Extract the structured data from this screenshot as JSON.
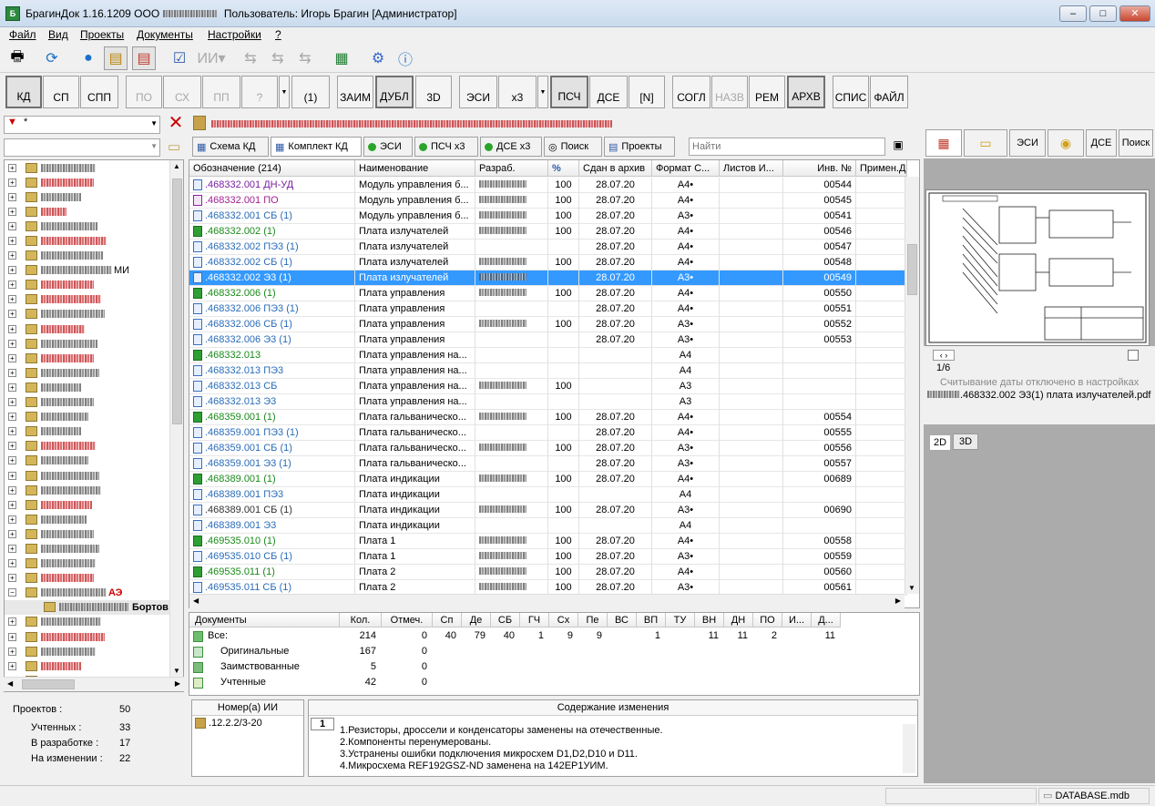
{
  "window": {
    "title": "БрагинДок 1.16.1209  ООО",
    "user": "Пользователь: Игорь Брагин  [Администратор]",
    "controls": [
      "–",
      "□",
      "✕"
    ]
  },
  "menu": [
    "Файл",
    "Вид",
    "Проекты",
    "Документы",
    "Настройки",
    "?"
  ],
  "doc_type_buttons": {
    "kd": "КД",
    "sp": "СП",
    "spp": "СПП",
    "po": "ПО",
    "sh": "СХ",
    "pp": "ПП",
    "q": "?",
    "one": "(1)",
    "zaim": "ЗАИМ",
    "dubl": "ДУБЛ",
    "d3": "3D",
    "esi": "ЭСИ",
    "x3": "x3",
    "psch": "ПСЧ",
    "dse": "ДСЕ",
    "n": "[N]",
    "sogl": "СОГЛ",
    "nazv": "НАЗВ",
    "rem": "РЕМ",
    "arhv": "АРХВ",
    "spis": "СПИС",
    "fail": "ФАЙЛ"
  },
  "filter": {
    "value": "*"
  },
  "tabs": {
    "schema": "Схема КД",
    "komplekt": "Комплект КД",
    "esi": "ЭСИ",
    "psch": "ПСЧ x3",
    "dse": "ДСЕ x3",
    "search": "Поиск",
    "projects": "Проекты",
    "search_placeholder": "Найти"
  },
  "grid": {
    "headers": [
      "Обозначение (214)",
      "Наименование",
      "Разраб.",
      "",
      "Сдан в архив",
      "Формат С...",
      "Листов И...",
      "Инв. №",
      "Примен.Д"
    ],
    "rows": [
      {
        "code": ".468332.001 ДН-УД",
        "name": "Модуль управления б...",
        "p": "100",
        "date": "28.07.20",
        "fmt": "А4•",
        "inv": "00544",
        "color": "#7a1fa2",
        "icon": "doc"
      },
      {
        "code": ".468332.001 ПО",
        "name": "Модуль управления б...",
        "p": "100",
        "date": "28.07.20",
        "fmt": "А4•",
        "inv": "00545",
        "color": "#a21f8f",
        "icon": "po"
      },
      {
        "code": ".468332.001 СБ (1)",
        "name": "Модуль управления б...",
        "p": "100",
        "date": "28.07.20",
        "fmt": "А3•",
        "inv": "00541",
        "color": "#2a6cb8",
        "icon": "doc"
      },
      {
        "code": ".468332.002 (1)",
        "name": "Плата излучателей",
        "p": "100",
        "date": "28.07.20",
        "fmt": "А4•",
        "inv": "00546",
        "color": "#1a8a1a",
        "icon": "green"
      },
      {
        "code": ".468332.002 ПЭ3 (1)",
        "name": "Плата излучателей",
        "p": "",
        "date": "28.07.20",
        "fmt": "А4•",
        "inv": "00547",
        "color": "#2a6cb8",
        "icon": "doc"
      },
      {
        "code": ".468332.002 СБ (1)",
        "name": "Плата излучателей",
        "p": "100",
        "date": "28.07.20",
        "fmt": "А4•",
        "inv": "00548",
        "color": "#2a6cb8",
        "icon": "doc"
      },
      {
        "code": ".468332.002 Э3 (1)",
        "name": "Плата излучателей",
        "p": "",
        "date": "28.07.20",
        "fmt": "А3•",
        "inv": "00549",
        "color": "#ffffff",
        "icon": "doc",
        "selected": true
      },
      {
        "code": ".468332.006 (1)",
        "name": "Плата управления",
        "p": "100",
        "date": "28.07.20",
        "fmt": "А4•",
        "inv": "00550",
        "color": "#1a8a1a",
        "icon": "green"
      },
      {
        "code": ".468332.006 ПЭ3 (1)",
        "name": "Плата управления",
        "p": "",
        "date": "28.07.20",
        "fmt": "А4•",
        "inv": "00551",
        "color": "#2a6cb8",
        "icon": "doc"
      },
      {
        "code": ".468332.006 СБ (1)",
        "name": "Плата управления",
        "p": "100",
        "date": "28.07.20",
        "fmt": "А3•",
        "inv": "00552",
        "color": "#2a6cb8",
        "icon": "doc"
      },
      {
        "code": ".468332.006 Э3 (1)",
        "name": "Плата управления",
        "p": "",
        "date": "28.07.20",
        "fmt": "А3•",
        "inv": "00553",
        "color": "#2a6cb8",
        "icon": "doc"
      },
      {
        "code": ".468332.013",
        "name": "Плата управления на...",
        "p": "",
        "date": "",
        "fmt": "А4",
        "inv": "",
        "color": "#1a8a1a",
        "icon": "green"
      },
      {
        "code": ".468332.013 ПЭ3",
        "name": "Плата управления на...",
        "p": "",
        "date": "",
        "fmt": "А4",
        "inv": "",
        "color": "#2a6cb8",
        "icon": "doc"
      },
      {
        "code": ".468332.013 СБ",
        "name": "Плата управления на...",
        "p": "100",
        "date": "",
        "fmt": "А3",
        "inv": "",
        "color": "#2a6cb8",
        "icon": "doc"
      },
      {
        "code": ".468332.013 Э3",
        "name": "Плата управления на...",
        "p": "",
        "date": "",
        "fmt": "А3",
        "inv": "",
        "color": "#2a6cb8",
        "icon": "doc"
      },
      {
        "code": ".468359.001 (1)",
        "name": "Плата гальваническо...",
        "p": "100",
        "date": "28.07.20",
        "fmt": "А4•",
        "inv": "00554",
        "color": "#1a8a1a",
        "icon": "green"
      },
      {
        "code": ".468359.001 ПЭ3 (1)",
        "name": "Плата гальваническо...",
        "p": "",
        "date": "28.07.20",
        "fmt": "А4•",
        "inv": "00555",
        "color": "#2a6cb8",
        "icon": "doc"
      },
      {
        "code": ".468359.001 СБ (1)",
        "name": "Плата гальваническо...",
        "p": "100",
        "date": "28.07.20",
        "fmt": "А3•",
        "inv": "00556",
        "color": "#2a6cb8",
        "icon": "doc"
      },
      {
        "code": ".468359.001 Э3 (1)",
        "name": "Плата гальваническо...",
        "p": "",
        "date": "28.07.20",
        "fmt": "А3•",
        "inv": "00557",
        "color": "#2a6cb8",
        "icon": "doc"
      },
      {
        "code": ".468389.001 (1)",
        "name": "Плата индикации",
        "p": "100",
        "date": "28.07.20",
        "fmt": "А4•",
        "inv": "00689",
        "color": "#1a8a1a",
        "icon": "green"
      },
      {
        "code": ".468389.001 ПЭ3",
        "name": "Плата индикации",
        "p": "",
        "date": "",
        "fmt": "А4",
        "inv": "",
        "color": "#2a6cb8",
        "icon": "doc"
      },
      {
        "code": ".468389.001 СБ (1)",
        "name": "Плата индикации",
        "p": "100",
        "date": "28.07.20",
        "fmt": "А3•",
        "inv": "00690",
        "color": "#333333",
        "icon": "doc"
      },
      {
        "code": ".468389.001 Э3",
        "name": "Плата индикации",
        "p": "",
        "date": "",
        "fmt": "А4",
        "inv": "",
        "color": "#2a6cb8",
        "icon": "doc"
      },
      {
        "code": ".469535.010 (1)",
        "name": "Плата 1",
        "p": "100",
        "date": "28.07.20",
        "fmt": "А4•",
        "inv": "00558",
        "color": "#1a8a1a",
        "icon": "green"
      },
      {
        "code": ".469535.010 СБ (1)",
        "name": "Плата 1",
        "p": "100",
        "date": "28.07.20",
        "fmt": "А3•",
        "inv": "00559",
        "color": "#2a6cb8",
        "icon": "doc"
      },
      {
        "code": ".469535.011 (1)",
        "name": "Плата 2",
        "p": "100",
        "date": "28.07.20",
        "fmt": "А4•",
        "inv": "00560",
        "color": "#1a8a1a",
        "icon": "green"
      },
      {
        "code": ".469535.011 СБ (1)",
        "name": "Плата 2",
        "p": "100",
        "date": "28.07.20",
        "fmt": "А3•",
        "inv": "00561",
        "color": "#2a6cb8",
        "icon": "doc"
      }
    ]
  },
  "summary": {
    "headers": [
      "Документы",
      "Кол.",
      "Отмеч.",
      "Сп",
      "Де",
      "СБ",
      "ГЧ",
      "Сх",
      "Пе",
      "ВС",
      "ВП",
      "ТУ",
      "ВН",
      "ДН",
      "ПО",
      "И...",
      "Д..."
    ],
    "rows": [
      {
        "label": "Все:",
        "vals": [
          "214",
          "0",
          "40",
          "79",
          "40",
          "1",
          "9",
          "9",
          "",
          "1",
          "",
          "11",
          "11",
          "2",
          "",
          "11"
        ]
      },
      {
        "label": "Оригинальные",
        "vals": [
          "167",
          "0",
          "",
          "",
          "",
          "",
          "",
          "",
          "",
          "",
          "",
          "",
          "",
          "",
          "",
          ""
        ]
      },
      {
        "label": "Заимствованные",
        "vals": [
          "5",
          "0",
          "",
          "",
          "",
          "",
          "",
          "",
          "",
          "",
          "",
          "",
          "",
          "",
          "",
          ""
        ]
      },
      {
        "label": "Учтенные",
        "vals": [
          "42",
          "0",
          "",
          "",
          "",
          "",
          "",
          "",
          "",
          "",
          "",
          "",
          "",
          "",
          "",
          ""
        ]
      }
    ]
  },
  "stats": [
    {
      "label": "Проектов :",
      "value": "50"
    },
    {
      "label": "Учтенных :",
      "value": "33"
    },
    {
      "label": "В разработке :",
      "value": "17"
    },
    {
      "label": "На изменении :",
      "value": "22"
    }
  ],
  "tree": {
    "selected_child": "Бортов",
    "highlight_item": "АЭ",
    "item_mi": "МИ"
  },
  "notices": {
    "header": "Номер(а) ИИ",
    "item": ".12.2.2/3-20"
  },
  "changes": {
    "header": "Содержание изменения",
    "number": "1",
    "lines": [
      "1.Резисторы, дроссели и конденсаторы заменены на отечественные.",
      "2.Компоненты перенумерованы.",
      "3.Устранены ошибки подключения микросхем D1,D2,D10 и D11.",
      "4.Микросхема REF192GSZ-ND заменена на 142ЕР1УИМ."
    ]
  },
  "right": {
    "tabs": {
      "esi": "ЭСИ",
      "dse": "ДСЕ",
      "search": "Поиск"
    },
    "page": "1/6",
    "read_disabled": "Считывание даты отключено в настройках",
    "file": ".468332.002 Э3(1) плата излучателей.pdf",
    "view2d": "2D",
    "view3d": "3D"
  },
  "status": {
    "db": "DATABASE.mdb"
  }
}
